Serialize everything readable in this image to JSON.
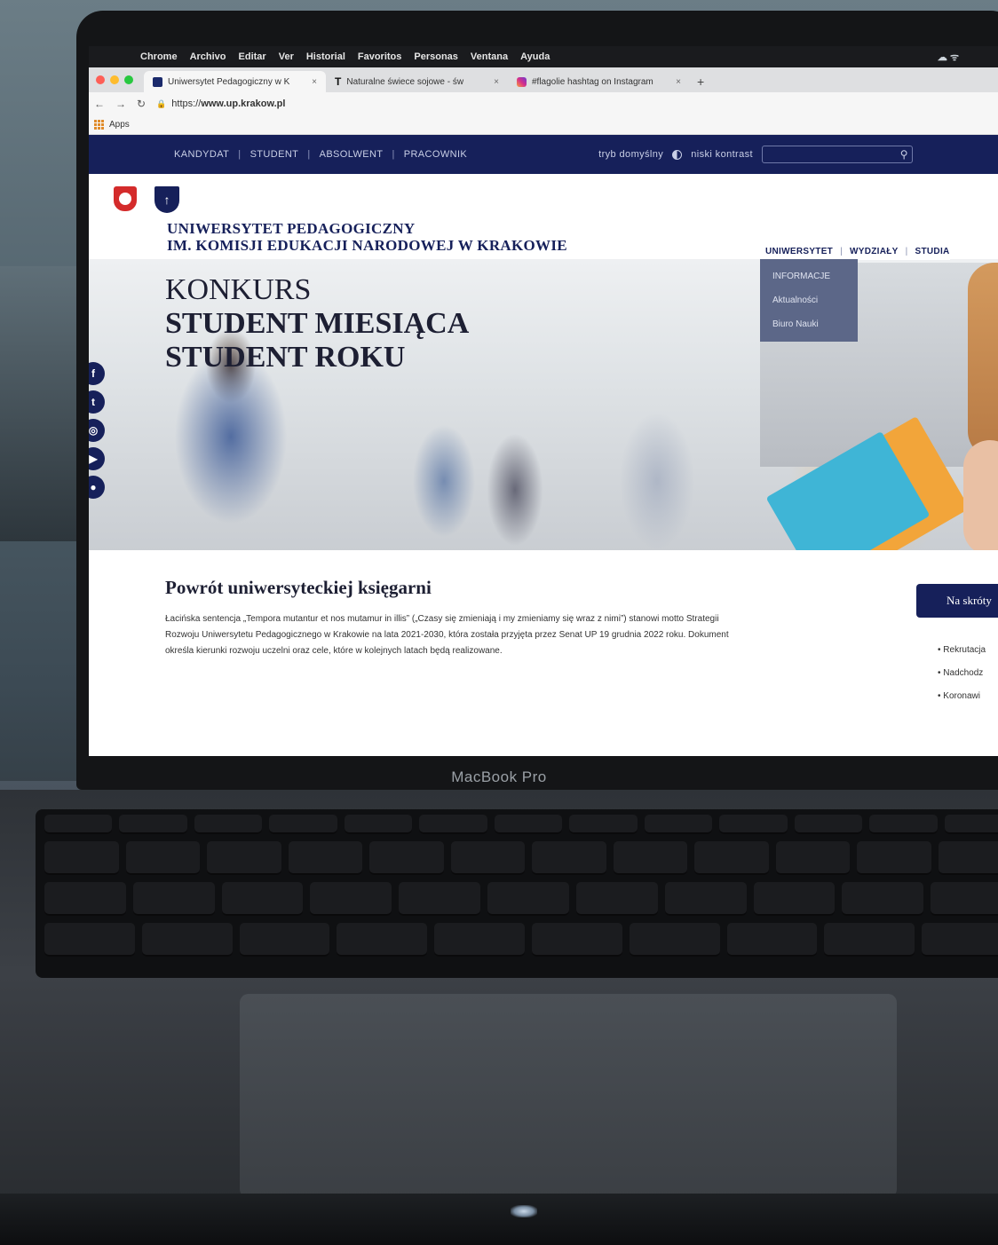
{
  "mac_menu": {
    "items": [
      "Chrome",
      "Archivo",
      "Editar",
      "Ver",
      "Historial",
      "Favoritos",
      "Personas",
      "Ventana",
      "Ayuda"
    ]
  },
  "browser": {
    "tabs": [
      {
        "title": "Uniwersytet Pedagogiczny w K",
        "icon": "university-favicon-icon"
      },
      {
        "title": "Naturalne świece sojowe - św",
        "icon": "t-favicon-icon"
      },
      {
        "title": "#flagolie hashtag on Instagram",
        "icon": "instagram-favicon-icon"
      }
    ],
    "url_prefix": "https://",
    "url_host": "www.up.krakow.pl",
    "bookmarks_apps": "Apps"
  },
  "site": {
    "topnav": [
      "KANDYDAT",
      "STUDENT",
      "ABSOLWENT",
      "PRACOWNIK"
    ],
    "mode_default": "tryb domyślny",
    "low_contrast": "niski kontrast",
    "university_line1": "UNIWERSYTET PEDAGOGICZNY",
    "university_line2": "IM. KOMISJI EDUKACJI NARODOWEJ W KRAKOWIE",
    "headline": {
      "line1": "KONKURS",
      "line2": "STUDENT MIESIĄCA",
      "line3": "STUDENT ROKU"
    },
    "mainnav": [
      "UNIWERSYTET",
      "WYDZIAŁY",
      "STUDIA"
    ],
    "dropdown": [
      "INFORMACJE",
      "Aktualności",
      "Biuro Nauki"
    ],
    "social_icons": [
      "facebook-icon",
      "twitter-icon",
      "instagram-icon",
      "youtube-icon",
      "snapchat-icon"
    ],
    "article": {
      "title": "Powrót uniwersyteckiej księgarni",
      "body": "Łacińska sentencja „Tempora mutantur et nos mutamur in illis” („Czasy się zmieniają i my zmieniamy się wraz z nimi”) stanowi motto Strategii Rozwoju Uniwersytetu Pedagogicznego w Krakowie na lata 2021-2030, która została przyjęta przez Senat UP 19 grudnia 2022 roku. Dokument określa kierunki rozwoju uczelni oraz cele, które w kolejnych latach będą realizowane."
    },
    "quick": {
      "button": "Na skróty",
      "items": [
        "• Rekrutacja",
        "• Nadchodz",
        "• Koronawi"
      ]
    }
  },
  "device_label": "MacBook Pro"
}
